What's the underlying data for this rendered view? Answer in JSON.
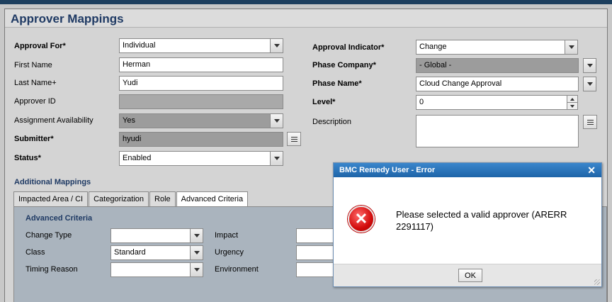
{
  "page": {
    "title": "Approver Mappings"
  },
  "form": {
    "approval_for": {
      "label": "Approval For*",
      "value": "Individual"
    },
    "first_name": {
      "label": "First Name",
      "value": "Herman"
    },
    "last_name": {
      "label": "Last Name+",
      "value": "Yudi"
    },
    "approver_id": {
      "label": "Approver ID",
      "value": ""
    },
    "assignment_availability": {
      "label": "Assignment Availability",
      "value": "Yes"
    },
    "submitter": {
      "label": "Submitter*",
      "value": "hyudi"
    },
    "status": {
      "label": "Status*",
      "value": "Enabled"
    },
    "approval_indicator": {
      "label": "Approval Indicator*",
      "value": "Change"
    },
    "phase_company": {
      "label": "Phase Company*",
      "value": "- Global -"
    },
    "phase_name": {
      "label": "Phase Name*",
      "value": "Cloud Change Approval"
    },
    "level": {
      "label": "Level*",
      "value": "0"
    },
    "description": {
      "label": "Description",
      "value": ""
    }
  },
  "additional": {
    "title": "Additional Mappings",
    "tabs": [
      {
        "label": "Impacted Area / CI"
      },
      {
        "label": "Categorization"
      },
      {
        "label": "Role"
      },
      {
        "label": "Advanced Criteria"
      }
    ],
    "advanced": {
      "title": "Advanced Criteria",
      "change_type": {
        "label": "Change Type",
        "value": ""
      },
      "class": {
        "label": "Class",
        "value": "Standard"
      },
      "timing_reason": {
        "label": "Timing Reason",
        "value": ""
      },
      "impact": {
        "label": "Impact",
        "value": ""
      },
      "urgency": {
        "label": "Urgency",
        "value": ""
      },
      "environment": {
        "label": "Environment",
        "value": ""
      }
    }
  },
  "dialog": {
    "title": "BMC Remedy User - Error",
    "close": "✕",
    "message": "Please selected a valid approver (ARERR 2291117)",
    "ok_label": "OK"
  },
  "colors": {
    "title_text": "#1f3a64",
    "dialog_header": "#2a75bb",
    "error_red": "#d20c0c"
  },
  "icons": {
    "error": "error-x-icon",
    "list": "list-menu-icon",
    "dropdown": "chevron-down-icon"
  }
}
